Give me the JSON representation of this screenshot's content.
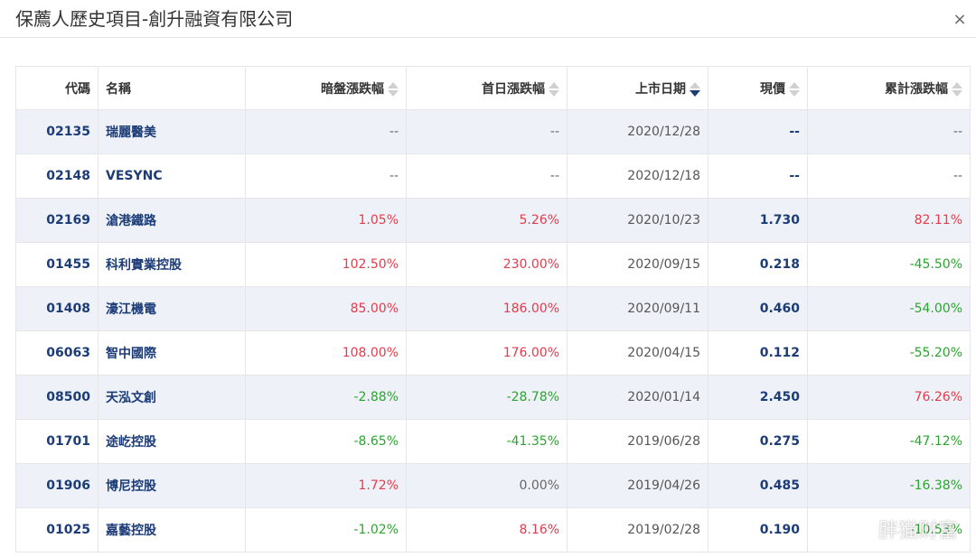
{
  "dialog": {
    "title": "保薦人歷史項目-創升融資有限公司",
    "close_glyph": "×"
  },
  "table": {
    "headers": {
      "code": "代碼",
      "name": "名稱",
      "grey": "暗盤漲跌幅",
      "first_day": "首日漲跌幅",
      "listing_date": "上市日期",
      "price": "現價",
      "cumulative": "累計漲跌幅"
    },
    "sort": {
      "column": "listing_date",
      "direction": "desc"
    },
    "rows": [
      {
        "code": "02135",
        "name": "瑞麗醫美",
        "grey": "--",
        "first_day": "--",
        "listing_date": "2020/12/28",
        "price": "--",
        "cumulative": "--"
      },
      {
        "code": "02148",
        "name": "VESYNC",
        "grey": "--",
        "first_day": "--",
        "listing_date": "2020/12/18",
        "price": "--",
        "cumulative": "--"
      },
      {
        "code": "02169",
        "name": "滄港鐵路",
        "grey": "1.05%",
        "first_day": "5.26%",
        "listing_date": "2020/10/23",
        "price": "1.730",
        "cumulative": "82.11%"
      },
      {
        "code": "01455",
        "name": "科利實業控股",
        "grey": "102.50%",
        "first_day": "230.00%",
        "listing_date": "2020/09/15",
        "price": "0.218",
        "cumulative": "-45.50%"
      },
      {
        "code": "01408",
        "name": "濠江機電",
        "grey": "85.00%",
        "first_day": "186.00%",
        "listing_date": "2020/09/11",
        "price": "0.460",
        "cumulative": "-54.00%"
      },
      {
        "code": "06063",
        "name": "智中國際",
        "grey": "108.00%",
        "first_day": "176.00%",
        "listing_date": "2020/04/15",
        "price": "0.112",
        "cumulative": "-55.20%"
      },
      {
        "code": "08500",
        "name": "天泓文創",
        "grey": "-2.88%",
        "first_day": "-28.78%",
        "listing_date": "2020/01/14",
        "price": "2.450",
        "cumulative": "76.26%"
      },
      {
        "code": "01701",
        "name": "途屹控股",
        "grey": "-8.65%",
        "first_day": "-41.35%",
        "listing_date": "2019/06/28",
        "price": "0.275",
        "cumulative": "-47.12%"
      },
      {
        "code": "01906",
        "name": "博尼控股",
        "grey": "1.72%",
        "first_day": "0.00%",
        "listing_date": "2019/04/26",
        "price": "0.485",
        "cumulative": "-16.38%"
      },
      {
        "code": "01025",
        "name": "嘉藝控股",
        "grey": "-1.02%",
        "first_day": "8.16%",
        "listing_date": "2019/02/28",
        "price": "0.190",
        "cumulative": "-10.53%"
      }
    ]
  },
  "colors": {
    "positive": "#e53b4b",
    "negative": "#2ba52e",
    "link": "#1c3c78",
    "row_stripe": "#eef2f8"
  },
  "watermark": {
    "main": "胖猫财富",
    "sub": "@胖猫财富"
  }
}
